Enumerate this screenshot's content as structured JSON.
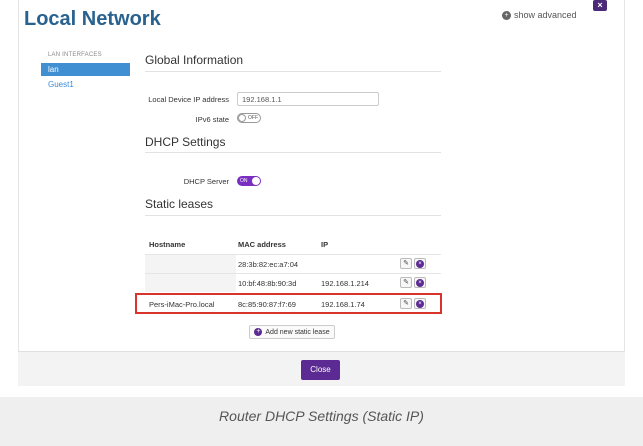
{
  "window": {
    "title": "Local Network",
    "show_advanced": "show advanced",
    "close_x": "×"
  },
  "sidebar": {
    "heading": "LAN INTERFACES",
    "items": [
      {
        "label": "lan",
        "active": true
      },
      {
        "label": "Guest1",
        "active": false
      }
    ]
  },
  "global": {
    "title": "Global Information",
    "ip_label": "Local Device IP address",
    "ip_value": "192.168.1.1",
    "ipv6_label": "IPv6 state",
    "ipv6_toggle": "OFF"
  },
  "dhcp": {
    "title": "DHCP Settings",
    "server_label": "DHCP Server",
    "server_toggle": "ON"
  },
  "static_leases": {
    "title": "Static leases",
    "columns": [
      "Hostname",
      "MAC address",
      "IP"
    ],
    "rows": [
      {
        "hostname": "",
        "mac": "28:3b:82:ec:a7:04",
        "ip": ""
      },
      {
        "hostname": "",
        "mac": "10:bf:48:8b:90:3d",
        "ip": "192.168.1.214"
      },
      {
        "hostname": "Pers-iMac-Pro.local",
        "mac": "8c:85:90:87:f7:69",
        "ip": "192.168.1.74"
      }
    ],
    "add_label": "Add new static lease"
  },
  "footer": {
    "close_label": "Close"
  },
  "caption": "Router DHCP Settings (Static IP)",
  "colors": {
    "accent": "#5b2a92",
    "title": "#29628f",
    "highlight": "#d9342b"
  }
}
